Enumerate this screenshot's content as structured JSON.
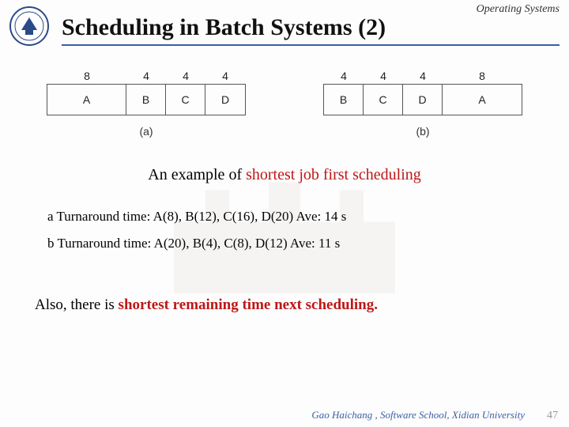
{
  "header": {
    "course_label": "Operating Systems",
    "title": "Scheduling in Batch Systems (2)"
  },
  "diagrams": {
    "a": {
      "durations": [
        "8",
        "4",
        "4",
        "4"
      ],
      "labels": [
        "A",
        "B",
        "C",
        "D"
      ],
      "widths": [
        100,
        50,
        50,
        50
      ],
      "caption": "(a)"
    },
    "b": {
      "durations": [
        "4",
        "4",
        "4",
        "8"
      ],
      "labels": [
        "B",
        "C",
        "D",
        "A"
      ],
      "widths": [
        50,
        50,
        50,
        100
      ],
      "caption": "(b)"
    }
  },
  "caption": {
    "prefix": "An example of ",
    "highlight": "shortest job first scheduling"
  },
  "lines": {
    "a": "a Turnaround time: A(8), B(12), C(16), D(20)  Ave: 14 s",
    "b": "b Turnaround time: A(20), B(4), C(8), D(12)   Ave: 11 s"
  },
  "closing": {
    "prefix": "Also, there is ",
    "highlight": "shortest remaining time next scheduling.",
    "suffix": ""
  },
  "footer": {
    "credit": "Gao Haichang , Software School, Xidian University",
    "page": "47"
  }
}
